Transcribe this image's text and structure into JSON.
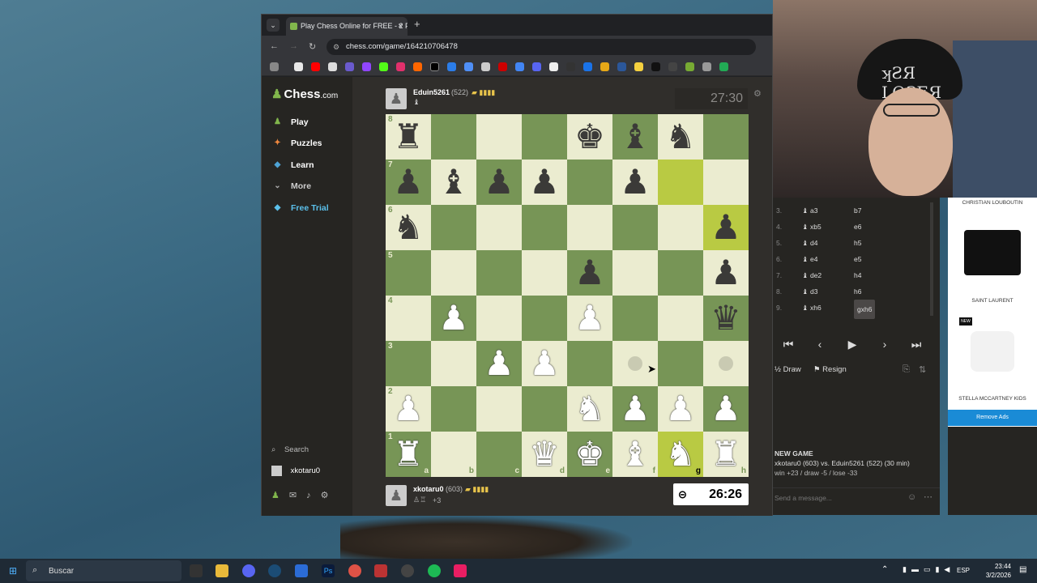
{
  "browser": {
    "tab_title": "Play Chess Online for FREE - 2 F",
    "tab_close": "×",
    "new_tab": "+",
    "url": "chess.com/game/164210706478"
  },
  "sidebar": {
    "logo": "Chess",
    "logo_suffix": ".com",
    "items": [
      {
        "label": "Play",
        "icon": "♟",
        "color": "#81b64c"
      },
      {
        "label": "Puzzles",
        "icon": "✦",
        "color": "#f0883e"
      },
      {
        "label": "Learn",
        "icon": "◆",
        "color": "#4ea3d5"
      },
      {
        "label": "More",
        "icon": "⌄",
        "color": "#888888"
      },
      {
        "label": "Free Trial",
        "icon": "◆",
        "color": "#5bc0eb"
      }
    ],
    "search": "Search",
    "username": "xkotaru0"
  },
  "top_player": {
    "name": "Eduin5261",
    "rating": "(522)",
    "clock": "27:30"
  },
  "bottom_player": {
    "name": "xkotaru0",
    "rating": "(603)",
    "captured": "+3",
    "clock": "26:26"
  },
  "board": {
    "ranks": [
      "8",
      "7",
      "6",
      "5",
      "4",
      "3",
      "2",
      "1"
    ],
    "files": [
      "a",
      "b",
      "c",
      "d",
      "e",
      "f",
      "g",
      "h"
    ],
    "position": [
      [
        "r",
        "",
        "",
        "",
        "k",
        "b",
        "n",
        ""
      ],
      [
        "p",
        "b",
        "p",
        "p",
        "",
        "p",
        "",
        ""
      ],
      [
        "n",
        "",
        "",
        "",
        "",
        "",
        "",
        "p"
      ],
      [
        "",
        "",
        "",
        "",
        "p",
        "",
        "",
        "p"
      ],
      [
        "",
        "P",
        "",
        "",
        "P",
        "",
        "",
        "q"
      ],
      [
        "",
        "",
        "P",
        "P",
        "",
        "",
        "",
        ""
      ],
      [
        "P",
        "",
        "",
        "",
        "N",
        "P",
        "P",
        "P"
      ],
      [
        "R",
        "",
        "",
        "Q",
        "K",
        "B",
        "N",
        "R"
      ]
    ],
    "highlighted": [
      "g7",
      "g1",
      "h6"
    ],
    "move_dots": [
      "f3",
      "h3"
    ]
  },
  "moves": [
    {
      "n": "3.",
      "w": "a3",
      "b": "b7"
    },
    {
      "n": "4.",
      "w": "xb5",
      "b": "e6"
    },
    {
      "n": "5.",
      "w": "d4",
      "b": "h5"
    },
    {
      "n": "6.",
      "w": "e4",
      "b": "e5"
    },
    {
      "n": "7.",
      "w": "de2",
      "b": "h4"
    },
    {
      "n": "8.",
      "w": "d3",
      "b": "h6"
    },
    {
      "n": "9.",
      "w": "xh6",
      "b": "gxh6"
    }
  ],
  "controls": {
    "first": "⏮",
    "prev": "‹",
    "play": "▶",
    "next": "›",
    "last": "⏭",
    "draw": "Draw",
    "resign": "Resign"
  },
  "new_game": {
    "heading": "NEW GAME",
    "line": "xkotaru0 (603) vs. Eduin5261 (522) (30 min)",
    "stats": "win +23 / draw -5 / lose -33"
  },
  "chat_placeholder": "Send a message...",
  "ad": {
    "brand1": "CHRISTIAN LOUBOUTIN",
    "brand2": "SAINT LAURENT",
    "badge": "NEW",
    "brand3": "STELLA MCCARTNEY KIDS",
    "remove": "Remove Ads"
  },
  "taskbar": {
    "search": "Buscar",
    "lang": "ESP",
    "time": "23:44",
    "date": "3/2/2026"
  }
}
